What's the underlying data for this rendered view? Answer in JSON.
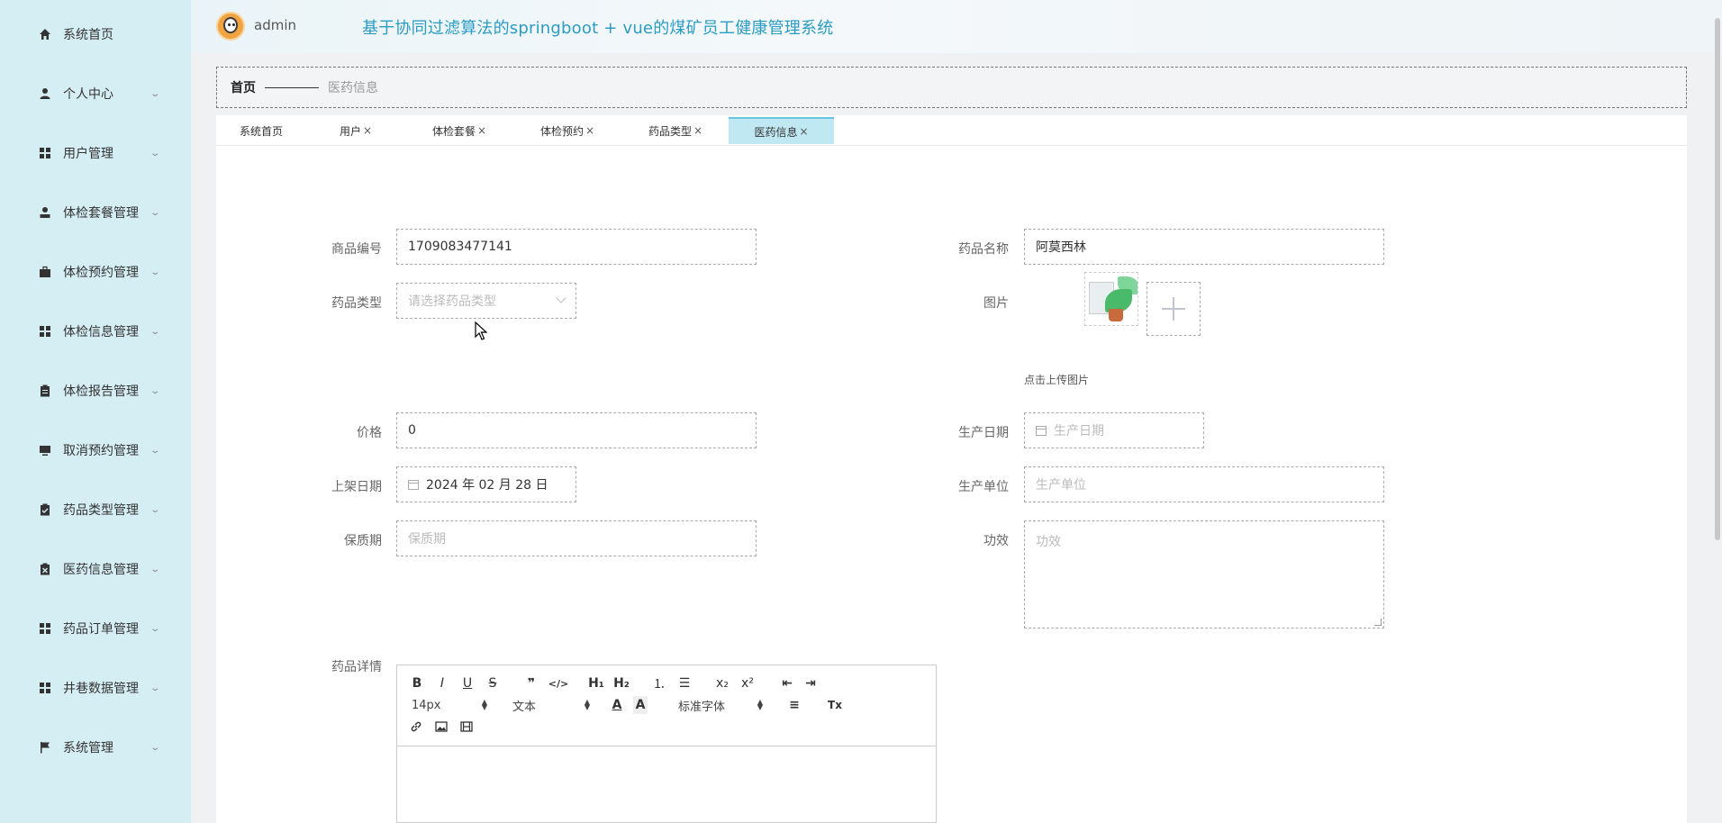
{
  "header": {
    "username": "admin",
    "system_title": "基于协同过滤算法的springboot + vue的煤矿员工健康管理系统"
  },
  "sidebar": {
    "items": [
      {
        "label": "系统首页",
        "icon": "home-icon",
        "has_submenu": false
      },
      {
        "label": "个人中心",
        "icon": "user-icon",
        "has_submenu": true
      },
      {
        "label": "用户管理",
        "icon": "grid-icon",
        "has_submenu": true
      },
      {
        "label": "体检套餐管理",
        "icon": "user-check-icon",
        "has_submenu": true
      },
      {
        "label": "体检预约管理",
        "icon": "briefcase-icon",
        "has_submenu": true
      },
      {
        "label": "体检信息管理",
        "icon": "grid-icon",
        "has_submenu": true
      },
      {
        "label": "体检报告管理",
        "icon": "clipboard-icon",
        "has_submenu": true
      },
      {
        "label": "取消预约管理",
        "icon": "monitor-icon",
        "has_submenu": true
      },
      {
        "label": "药品类型管理",
        "icon": "clipboard-check-icon",
        "has_submenu": true
      },
      {
        "label": "医药信息管理",
        "icon": "clipboard-x-icon",
        "has_submenu": true
      },
      {
        "label": "药品订单管理",
        "icon": "grid-icon",
        "has_submenu": true
      },
      {
        "label": "井巷数据管理",
        "icon": "grid-icon",
        "has_submenu": true
      },
      {
        "label": "系统管理",
        "icon": "flag-icon",
        "has_submenu": true
      }
    ]
  },
  "breadcrumb": {
    "home": "首页",
    "current": "医药信息"
  },
  "tabs": [
    {
      "label": "系统首页",
      "closable": false,
      "active": false
    },
    {
      "label": "用户",
      "closable": true,
      "active": false
    },
    {
      "label": "体检套餐",
      "closable": true,
      "active": false
    },
    {
      "label": "体检预约",
      "closable": true,
      "active": false
    },
    {
      "label": "药品类型",
      "closable": true,
      "active": false
    },
    {
      "label": "医药信息",
      "closable": true,
      "active": true
    }
  ],
  "tab_close_glyph": "×",
  "form": {
    "product_code": {
      "label": "商品编号",
      "value": "1709083477141"
    },
    "drug_name": {
      "label": "药品名称",
      "value": "阿莫西林"
    },
    "drug_type": {
      "label": "药品类型",
      "placeholder": "请选择药品类型"
    },
    "image": {
      "label": "图片",
      "upload_tip": "点击上传图片"
    },
    "price": {
      "label": "价格",
      "value": "0"
    },
    "production_date": {
      "label": "生产日期",
      "placeholder": "生产日期"
    },
    "shelf_date": {
      "label": "上架日期",
      "value": "2024 年 02 月 28 日"
    },
    "manufacturer": {
      "label": "生产单位",
      "placeholder": "生产单位"
    },
    "shelf_life": {
      "label": "保质期",
      "placeholder": "保质期"
    },
    "efficacy": {
      "label": "功效",
      "placeholder": "功效"
    },
    "details": {
      "label": "药品详情"
    }
  },
  "editor": {
    "font_size": "14px",
    "header_select": "文本",
    "font_family": "标准字体",
    "buttons": {
      "bold": "B",
      "italic": "I",
      "underline": "U",
      "strike": "S",
      "quote": "❞",
      "code": "</>",
      "h1": "H₁",
      "h2": "H₂",
      "ordered_list": "⒈",
      "bullet_list": "☰",
      "subscript": "x₂",
      "superscript": "x²",
      "outdent": "⇤",
      "indent": "⇥",
      "color": "A",
      "background": "A",
      "align": "≡",
      "clean": "Tx",
      "link": "🔗",
      "image": "▣",
      "video": "▦"
    }
  },
  "colors": {
    "sidebar_bg": "#d5eef4",
    "title_color": "#2b9cc2",
    "active_tab_bg": "#bfe8f3"
  }
}
